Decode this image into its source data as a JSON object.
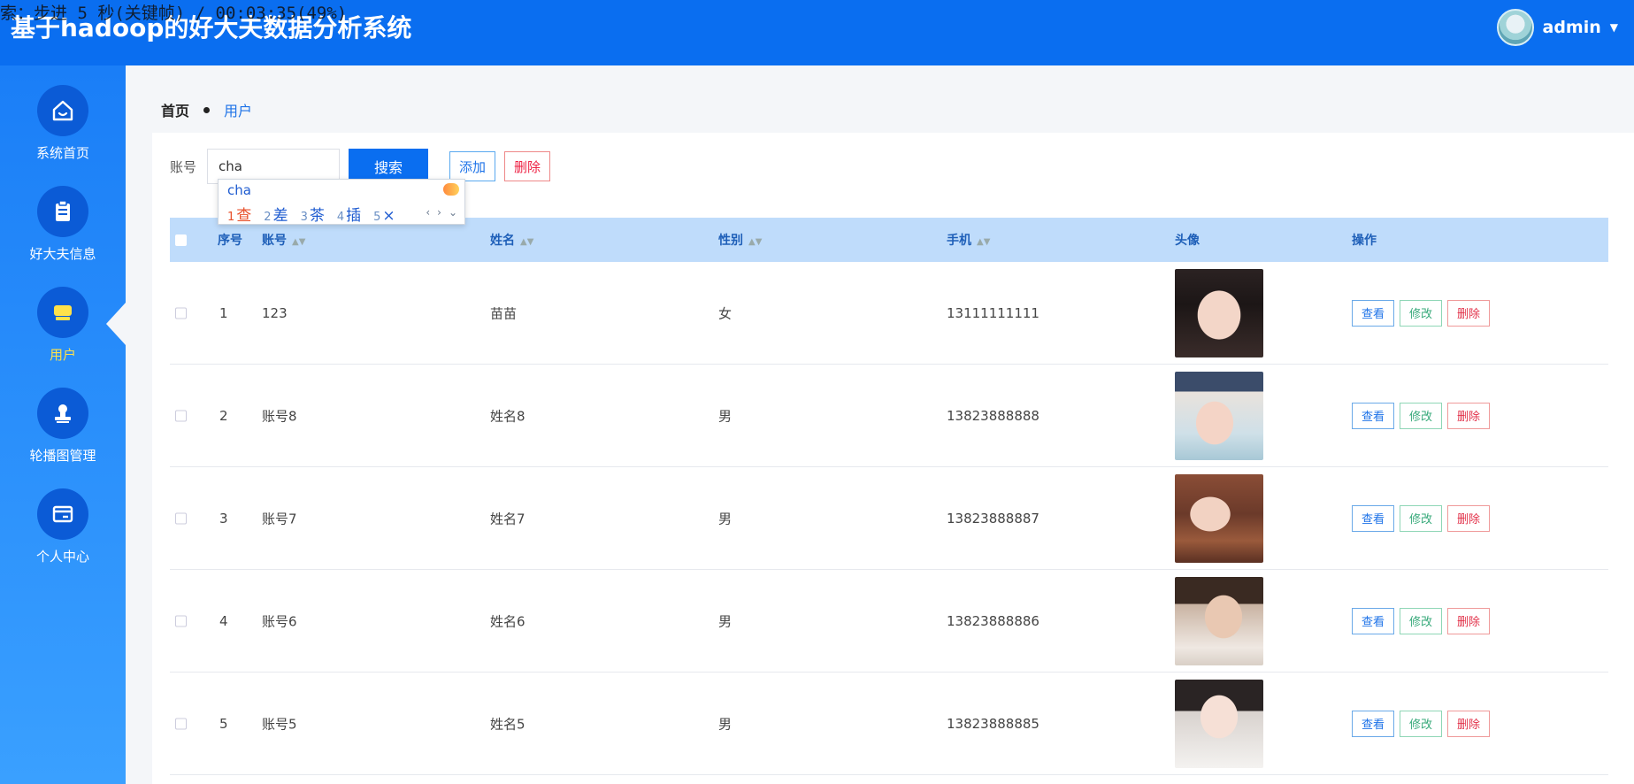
{
  "overlay": {
    "text": "索：步进 5 秒(关键帧) / 00:03:35(49%)"
  },
  "header": {
    "title": "基于hadoop的好大夫数据分析系统",
    "user": {
      "name": "admin"
    }
  },
  "sidebar": {
    "items": [
      {
        "label": "系统首页",
        "icon": "home-icon"
      },
      {
        "label": "好大夫信息",
        "icon": "clipboard-icon"
      },
      {
        "label": "用户",
        "icon": "user-group-icon",
        "active": true
      },
      {
        "label": "轮播图管理",
        "icon": "stamp-icon"
      },
      {
        "label": "个人中心",
        "icon": "card-icon"
      }
    ]
  },
  "breadcrumb": {
    "home": "首页",
    "current": "用户"
  },
  "search": {
    "label": "账号",
    "value": "cha",
    "search_button": "搜索",
    "add_button": "添加",
    "delete_button": "删除"
  },
  "ime": {
    "pinyin": "cha",
    "candidates": [
      {
        "num": "1",
        "text": "查"
      },
      {
        "num": "2",
        "text": "差"
      },
      {
        "num": "3",
        "text": "茶"
      },
      {
        "num": "4",
        "text": "插"
      },
      {
        "num": "5",
        "text": "×"
      }
    ]
  },
  "table": {
    "columns": [
      "序号",
      "账号",
      "姓名",
      "性别",
      "手机",
      "头像",
      "操作"
    ],
    "rows": [
      {
        "index": "1",
        "account": "123",
        "name": "苗苗",
        "gender": "女",
        "phone": "13111111111"
      },
      {
        "index": "2",
        "account": "账号8",
        "name": "姓名8",
        "gender": "男",
        "phone": "13823888888"
      },
      {
        "index": "3",
        "account": "账号7",
        "name": "姓名7",
        "gender": "男",
        "phone": "13823888887"
      },
      {
        "index": "4",
        "account": "账号6",
        "name": "姓名6",
        "gender": "男",
        "phone": "13823888886"
      },
      {
        "index": "5",
        "account": "账号5",
        "name": "姓名5",
        "gender": "男",
        "phone": "13823888885"
      }
    ],
    "actions": {
      "view": "查看",
      "edit": "修改",
      "delete": "删除"
    }
  },
  "colors": {
    "primary": "#0a6ef0",
    "active_nav": "#ffe24a",
    "table_header": "#bfdcfb"
  }
}
